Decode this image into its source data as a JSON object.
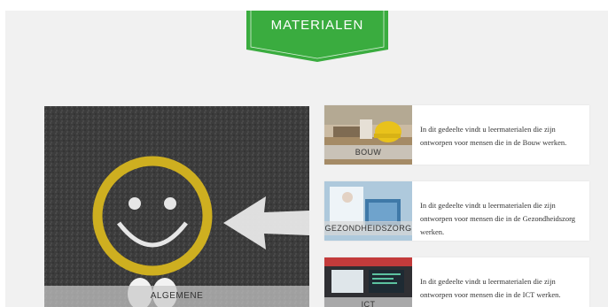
{
  "banner": {
    "title": "MATERIALEN",
    "color": "#3aac3f"
  },
  "featured": {
    "label": "ALGEMENE"
  },
  "cards": [
    {
      "label": "BOUW",
      "description": "In dit gedeelte vindt u leermaterialen die zijn ontworpen voor mensen die in de Bouw werken."
    },
    {
      "label": "GEZONDHEIDSZORG",
      "description": "In dit gedeelte vindt u leermaterialen die zijn ontworpen voor mensen die in de Gezondheidszorg werken."
    },
    {
      "label": "ICT",
      "description": "In dit gedeelte vindt u leermaterialen die zijn ontworpen voor mensen die in de ICT werken."
    }
  ]
}
